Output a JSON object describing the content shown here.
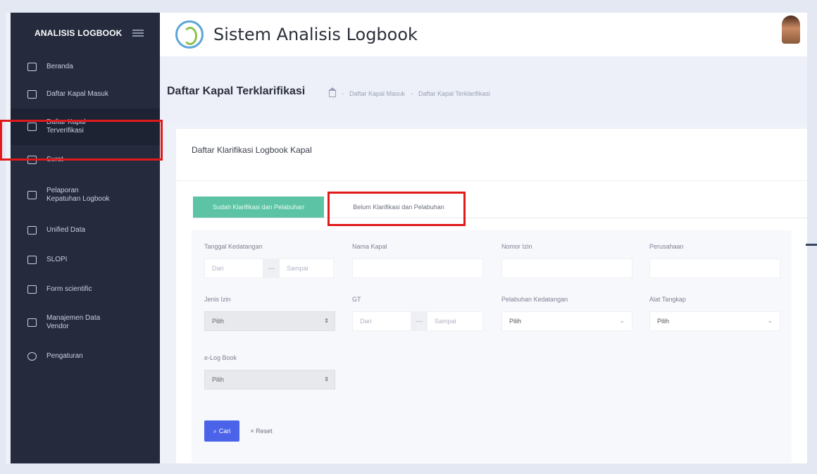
{
  "sidebar": {
    "brand": "ANALISIS LOGBOOK",
    "items": [
      {
        "label": "Beranda",
        "icon": "monitor-icon"
      },
      {
        "label": "Daftar Kapal Masuk",
        "icon": "calendar-icon"
      },
      {
        "label": "Daftar Kapal\nTerverifikasi",
        "icon": "calendar-icon"
      },
      {
        "label": "Surat",
        "icon": "calendar-icon"
      },
      {
        "label": "Pelaporan\nKepatuhan Logbook",
        "icon": "calendar-icon"
      },
      {
        "label": "Unified Data",
        "icon": "calendar-icon"
      },
      {
        "label": "SLOPI",
        "icon": "calendar-icon"
      },
      {
        "label": "Form scientific",
        "icon": "calendar-icon"
      },
      {
        "label": "Manajemen Data\nVendor",
        "icon": "calendar-icon"
      },
      {
        "label": "Pengaturan",
        "icon": "gear-icon"
      }
    ]
  },
  "header": {
    "title": "Sistem Analisis Logbook"
  },
  "page": {
    "title": "Daftar Kapal Terklarifikasi",
    "breadcrumb": [
      "Daftar Kapal Masuk",
      "Daftar Kapal Terklarifikasi"
    ]
  },
  "card": {
    "title": "Daftar Klarifikasi Logbook Kapal",
    "tabs": [
      "Sudah Klarifikasi dan Pelabuhan",
      "Belum Klarifikasi dan Pelabuhan"
    ]
  },
  "filters": {
    "tanggal_label": "Tanggal Kedatangan",
    "tanggal_from": "Dari",
    "tanggal_to": "Sampai",
    "nama_kapal_label": "Nama Kapal",
    "nomor_izin_label": "Nomor Izin",
    "perusahaan_label": "Perusahaan",
    "jenis_izin_label": "Jenis Izin",
    "jenis_izin_value": "Pilih",
    "gt_label": "GT",
    "gt_from": "Dari",
    "gt_to": "Sampai",
    "pelabuhan_label": "Pelabuhan Kedatangan",
    "pelabuhan_value": "Pilih",
    "alat_label": "Alat Tangkap",
    "alat_value": "Pilih",
    "elogbook_label": "e-Log Book",
    "elogbook_value": "Pilih",
    "range_sep": "—",
    "cari": "Cari",
    "reset": "× Reset"
  },
  "colors": {
    "highlight": "#e01a1a",
    "tab_active": "#5cc4a4",
    "primary": "#4a63e8",
    "sidebar": "#252b3d"
  }
}
